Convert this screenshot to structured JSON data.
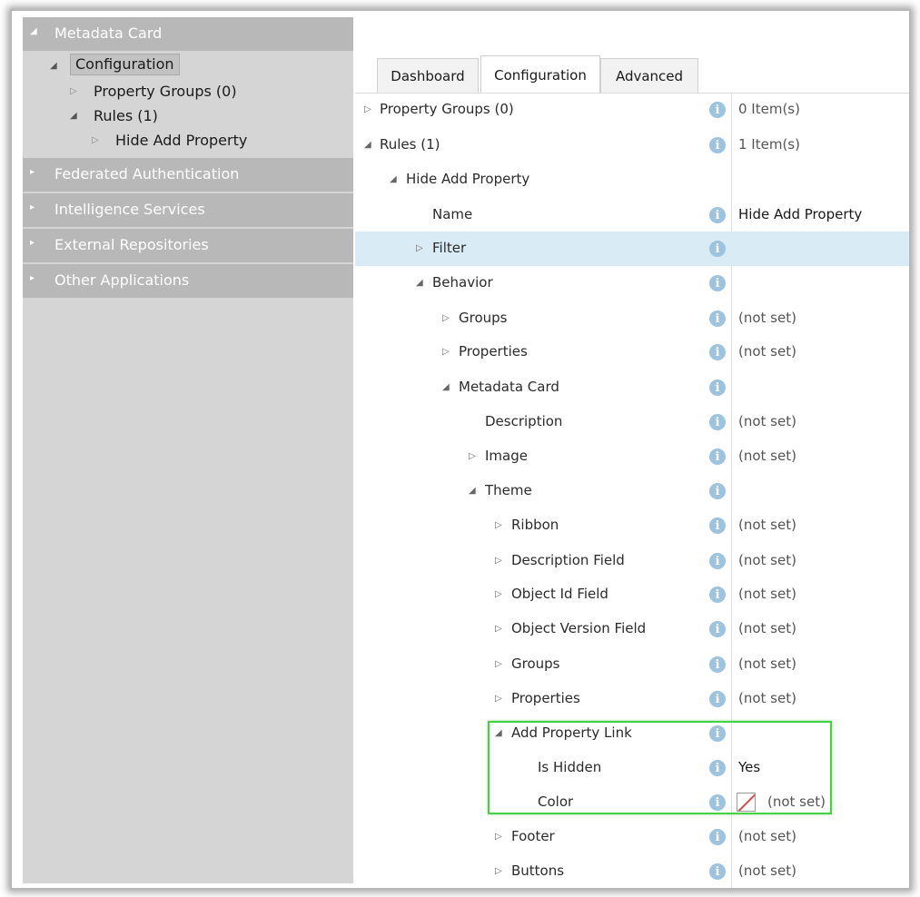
{
  "nav": {
    "sections": [
      {
        "label": "Metadata Card",
        "expanded": true
      },
      {
        "label": "Federated Authentication",
        "expanded": false
      },
      {
        "label": "Intelligence Services",
        "expanded": false
      },
      {
        "label": "External Repositories",
        "expanded": false
      },
      {
        "label": "Other Applications",
        "expanded": false
      }
    ],
    "tree": {
      "configuration": "Configuration",
      "property_groups": "Property Groups (0)",
      "rules": "Rules (1)",
      "hide_add_property": "Hide Add Property"
    }
  },
  "tabs": [
    {
      "label": "Dashboard",
      "active": false
    },
    {
      "label": "Configuration",
      "active": true
    },
    {
      "label": "Advanced",
      "active": false
    }
  ],
  "properties": [
    {
      "label": "Property Groups (0)",
      "expander": "collapsed",
      "value": "0 Item(s)"
    },
    {
      "label": "Rules (1)",
      "expander": "expanded",
      "value": "1 Item(s)"
    },
    {
      "label": "Hide Add Property",
      "expander": "expanded",
      "value": ""
    },
    {
      "label": "Name",
      "expander": "none",
      "value": "Hide Add Property"
    },
    {
      "label": "Filter",
      "expander": "collapsed",
      "value": "",
      "selected": true
    },
    {
      "label": "Behavior",
      "expander": "expanded",
      "value": ""
    },
    {
      "label": "Groups",
      "expander": "collapsed",
      "value": "(not set)"
    },
    {
      "label": "Properties",
      "expander": "collapsed",
      "value": "(not set)"
    },
    {
      "label": "Metadata Card",
      "expander": "expanded",
      "value": ""
    },
    {
      "label": "Description",
      "expander": "none",
      "value": "(not set)"
    },
    {
      "label": "Image",
      "expander": "collapsed",
      "value": "(not set)"
    },
    {
      "label": "Theme",
      "expander": "expanded",
      "value": ""
    },
    {
      "label": "Ribbon",
      "expander": "collapsed",
      "value": "(not set)"
    },
    {
      "label": "Description Field",
      "expander": "collapsed",
      "value": "(not set)"
    },
    {
      "label": "Object Id Field",
      "expander": "collapsed",
      "value": "(not set)"
    },
    {
      "label": "Object Version Field",
      "expander": "collapsed",
      "value": "(not set)"
    },
    {
      "label": "Groups",
      "expander": "collapsed",
      "value": "(not set)"
    },
    {
      "label": "Properties",
      "expander": "collapsed",
      "value": "(not set)"
    },
    {
      "label": "Add Property Link",
      "expander": "expanded",
      "value": ""
    },
    {
      "label": "Is Hidden",
      "expander": "none",
      "value": "Yes"
    },
    {
      "label": "Color",
      "expander": "none",
      "value": "(not set)",
      "swatch": true
    },
    {
      "label": "Footer",
      "expander": "collapsed",
      "value": "(not set)"
    },
    {
      "label": "Buttons",
      "expander": "collapsed",
      "value": "(not set)"
    }
  ],
  "info_icon_glyph": "i",
  "colors": {
    "section_header": "#b8b8b8",
    "tree_bg": "#d5d5d5",
    "selected_row": "#d9ebf4",
    "info_icon": "#9dc3df",
    "highlight_border": "#46d246",
    "swatch_slash": "#d14a4a"
  }
}
